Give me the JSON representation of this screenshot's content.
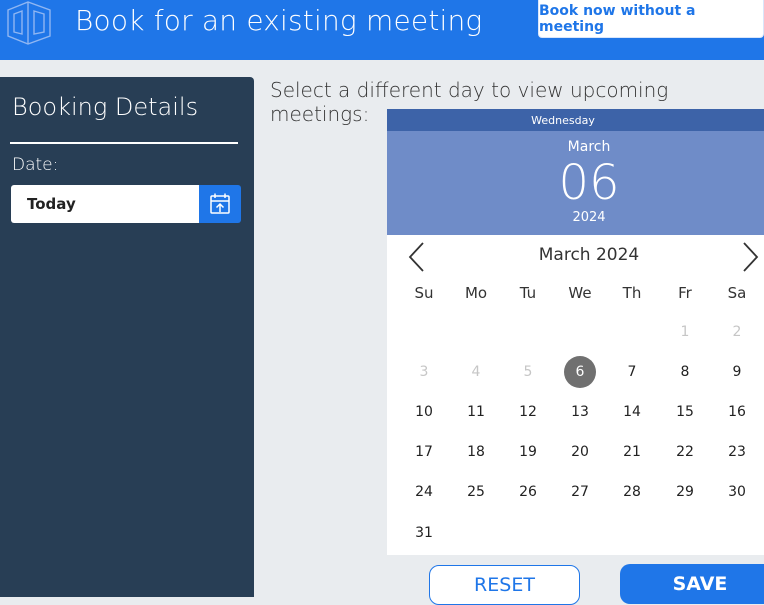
{
  "header": {
    "title": "Book for an existing meeting",
    "book_without_label": "Book now without a meeting",
    "logo_icon": "building-icon"
  },
  "booking_panel": {
    "title": "Booking Details",
    "date_label": "Date:",
    "date_value": "Today",
    "calendar_button_icon": "calendar-icon"
  },
  "instruction": "Select a different day to view upcoming meetings:",
  "calendar": {
    "weekday": "Wednesday",
    "selected_month": "March",
    "selected_day": "06",
    "selected_year": "2024",
    "month_year": "March 2024",
    "prev_icon": "chevron-left-icon",
    "next_icon": "chevron-right-icon",
    "weekdays": [
      "Su",
      "Mo",
      "Tu",
      "We",
      "Th",
      "Fr",
      "Sa"
    ],
    "weeks": [
      [
        "",
        "",
        "",
        "",
        "",
        "1",
        "2"
      ],
      [
        "3",
        "4",
        "5",
        "6",
        "7",
        "8",
        "9"
      ],
      [
        "10",
        "11",
        "12",
        "13",
        "14",
        "15",
        "16"
      ],
      [
        "17",
        "18",
        "19",
        "20",
        "21",
        "22",
        "23"
      ],
      [
        "24",
        "25",
        "26",
        "27",
        "28",
        "29",
        "30"
      ],
      [
        "31",
        "",
        "",
        "",
        "",
        "",
        ""
      ]
    ],
    "selected_date": "6",
    "muted_dates": [
      "1",
      "2",
      "3",
      "4",
      "5"
    ]
  },
  "actions": {
    "reset_label": "RESET",
    "save_label": "SAVE"
  },
  "colors": {
    "brand_blue": "#1f76e8",
    "panel_dark": "#283e55",
    "calendar_header": "#3d63a8",
    "calendar_hero": "#6f8cc8"
  }
}
